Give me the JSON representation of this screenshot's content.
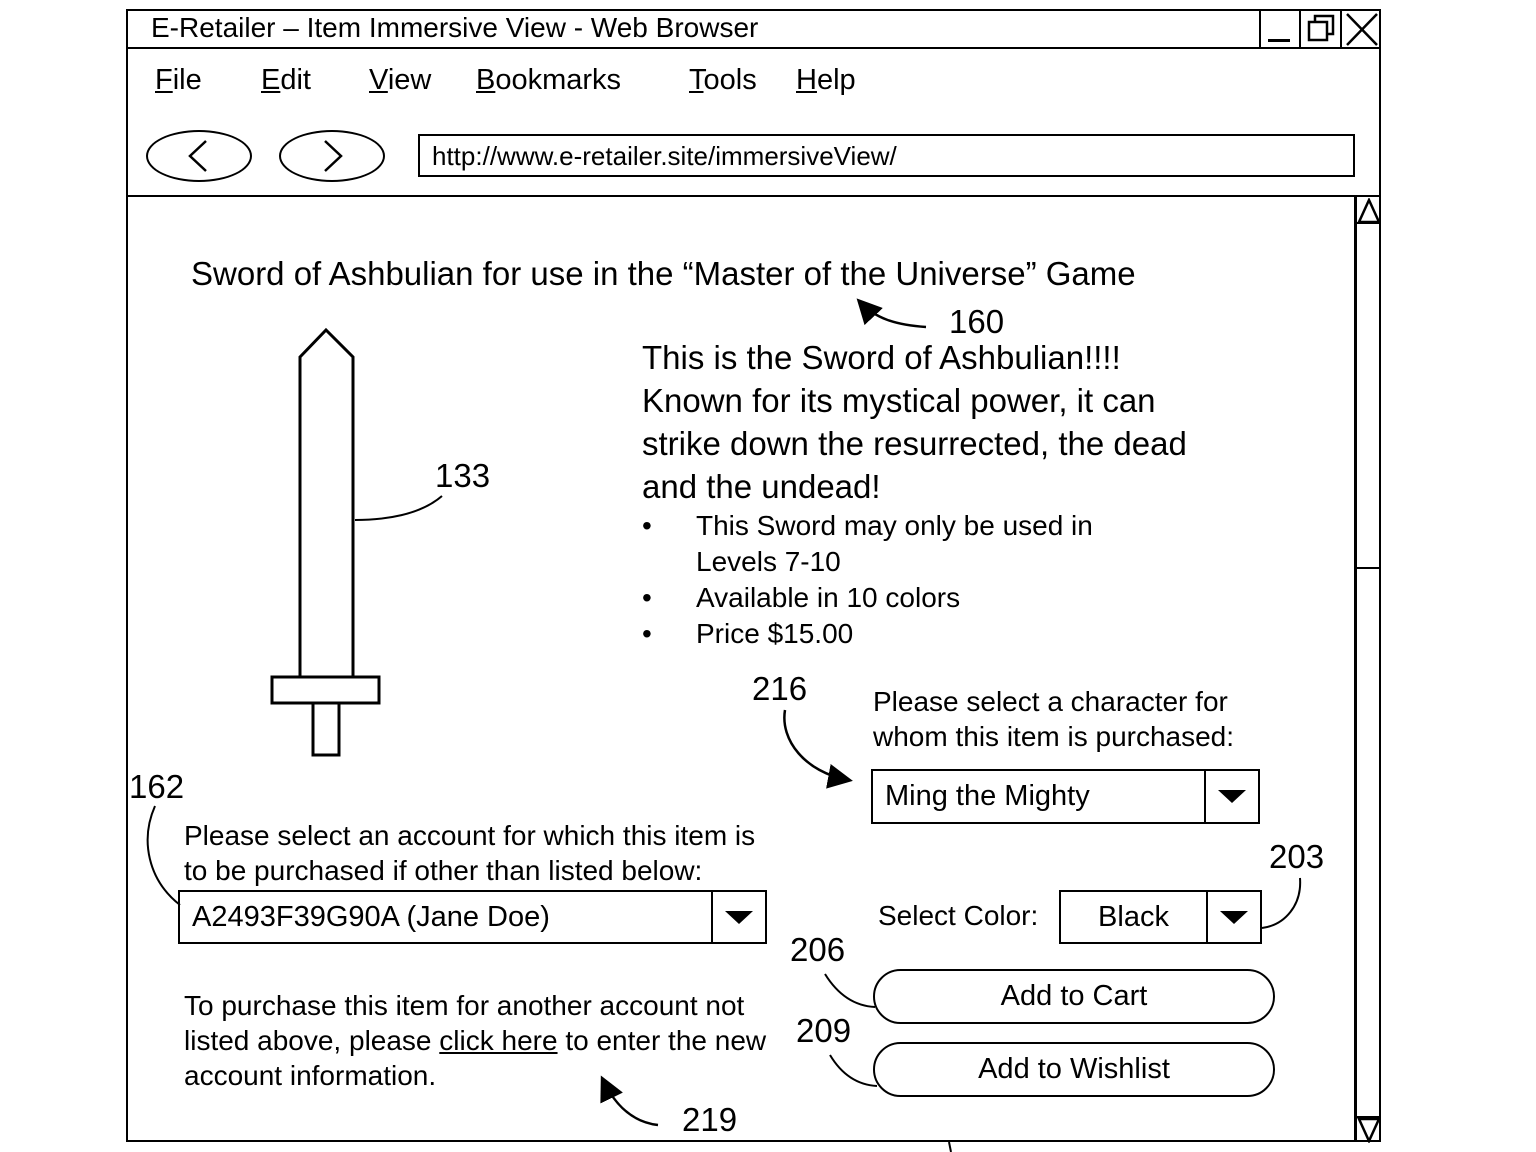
{
  "window": {
    "title": "E-Retailer – Item Immersive View - Web Browser",
    "controls": [
      "minimize-icon",
      "restore-icon",
      "close-icon"
    ]
  },
  "menu": [
    {
      "label": "File",
      "accel": "F",
      "rest": "ile"
    },
    {
      "label": "Edit",
      "accel": "E",
      "rest": "dit"
    },
    {
      "label": "View",
      "accel": "V",
      "rest": "iew"
    },
    {
      "label": "Bookmarks",
      "accel": "B",
      "rest": "ookmarks"
    },
    {
      "label": "Tools",
      "accel": "T",
      "rest": "ools"
    },
    {
      "label": "Help",
      "accel": "H",
      "rest": "elp"
    }
  ],
  "nav": {
    "back_icon": "chevron-left-icon",
    "forward_icon": "chevron-right-icon",
    "url": "http://www.e-retailer.site/immersiveView/"
  },
  "item": {
    "title": "Sword of Ashbulian for use in the “Master of the Universe” Game",
    "image": "sword-icon",
    "description": "This is the Sword of Ashbulian!!!! Known for its mystical power, it can strike down the resurrected, the dead and the undead!",
    "bullets": [
      "This Sword may only be used in Levels 7-10",
      "Available in 10 colors",
      "Price $15.00"
    ]
  },
  "character": {
    "label": "Please select a character for whom this item is purchased:",
    "selected": "Ming the Mighty"
  },
  "account": {
    "label": "Please select an account for which this item is to be purchased if other than listed below:",
    "selected": "A2493F39G90A (Jane Doe)"
  },
  "color": {
    "label": "Select Color:",
    "selected": "Black"
  },
  "buttons": {
    "add_to_cart": "Add to Cart",
    "add_to_wishlist": "Add to Wishlist"
  },
  "new_account": {
    "prefix": "To purchase this item for another account not listed above, please ",
    "link": "click here",
    "suffix": " to enter the new account information."
  },
  "reference_numerals": {
    "title": "160",
    "sword": "133",
    "account_select": "162",
    "character_select": "216",
    "color_select": "203",
    "add_to_cart": "206",
    "add_to_wishlist": "209",
    "click_here": "219"
  }
}
